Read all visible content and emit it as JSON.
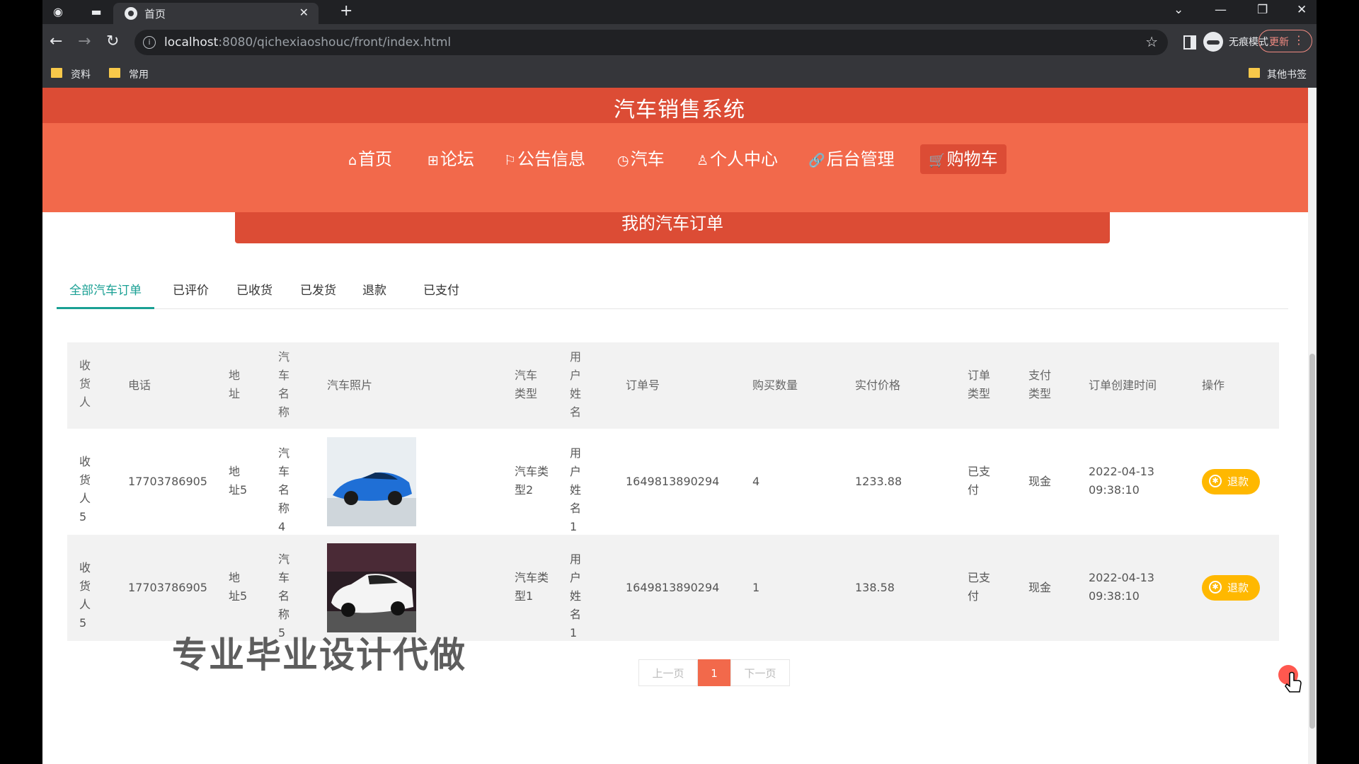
{
  "browser": {
    "tab_title": "首页",
    "url_host": "localhost",
    "url_rest": ":8080/qichexiaoshouc/front/index.html",
    "profile_label": "无痕模式",
    "update_label": "更新",
    "bookmarks": [
      "资料",
      "常用"
    ],
    "other_bookmarks": "其他书签"
  },
  "site": {
    "title": "汽车销售系统",
    "menu": [
      {
        "icon": "⌂",
        "label": "首页"
      },
      {
        "icon": "⊞",
        "label": "论坛"
      },
      {
        "icon": "⚐",
        "label": "公告信息"
      },
      {
        "icon": "◷",
        "label": "汽车"
      },
      {
        "icon": "♙",
        "label": "个人中心"
      },
      {
        "icon": "🔗",
        "label": "后台管理"
      },
      {
        "icon": "🛒",
        "label": "购物车"
      }
    ],
    "banner": "我的汽车订单"
  },
  "order_tabs": [
    "全部汽车订单",
    "已评价",
    "已收货",
    "已发货",
    "退款",
    "已支付"
  ],
  "table": {
    "headers": [
      "收货人",
      "电话",
      "地址",
      "汽车名称",
      "汽车照片",
      "汽车类型",
      "用户姓名",
      "订单号",
      "购买数量",
      "实付价格",
      "订单类型",
      "支付类型",
      "订单创建时间",
      "操作"
    ],
    "rows": [
      {
        "receiver": "收货人5",
        "phone": "17703786905",
        "address": "地址5",
        "car_name": "汽车名称4",
        "car_type": "汽车类型2",
        "user_name": "用户姓名1",
        "order_no": "1649813890294",
        "quantity": "4",
        "price": "1233.88",
        "order_type": "已支付",
        "pay_type": "现金",
        "created_date": "2022-04-13",
        "created_time": "09:38:10",
        "action": "退款",
        "photo_color": "#1f6fd6"
      },
      {
        "receiver": "收货人5",
        "phone": "17703786905",
        "address": "地址5",
        "car_name": "汽车名称5",
        "car_type": "汽车类型1",
        "user_name": "用户姓名1",
        "order_no": "1649813890294",
        "quantity": "1",
        "price": "138.58",
        "order_type": "已支付",
        "pay_type": "现金",
        "created_date": "2022-04-13",
        "created_time": "09:38:10",
        "action": "退款",
        "photo_color": "#f4f4f4"
      }
    ]
  },
  "pagination": {
    "prev": "上一页",
    "current": "1",
    "next": "下一页"
  },
  "watermark": "专业毕业设计代做",
  "colors": {
    "primary": "#f2694b",
    "dark_primary": "#dc4c35",
    "tab_active": "#1aa094",
    "action": "#ffb800"
  }
}
